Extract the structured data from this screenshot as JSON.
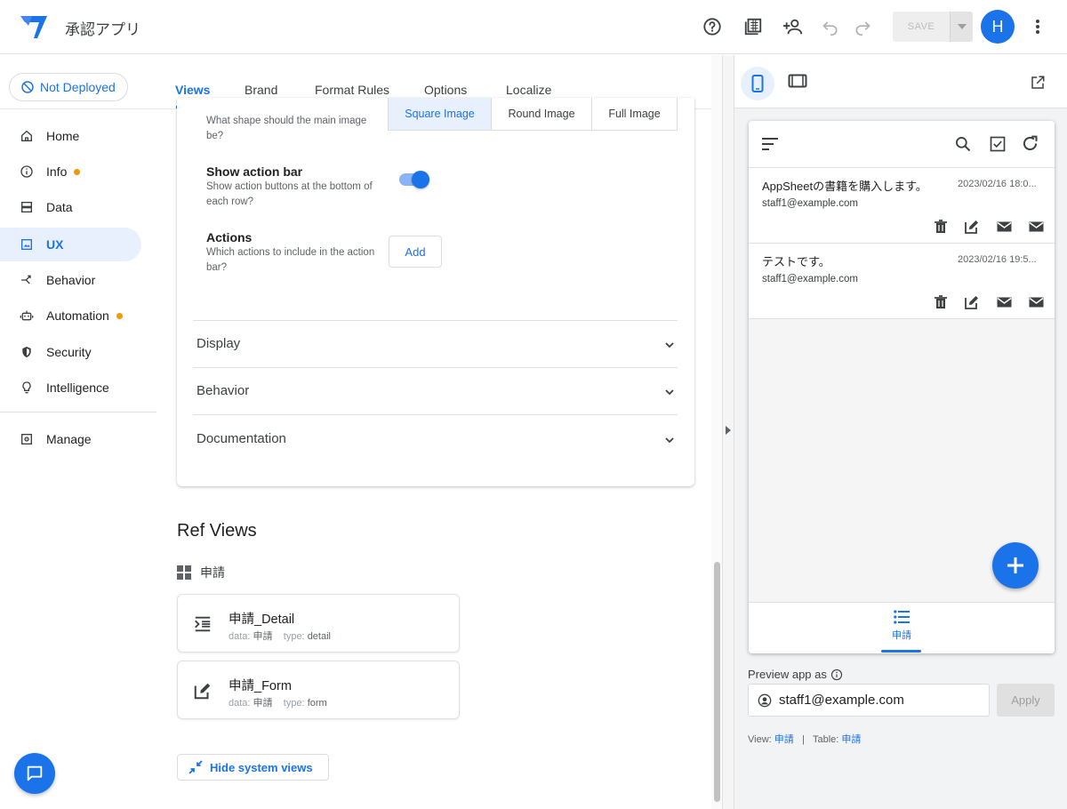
{
  "header": {
    "app_title": "承認アプリ",
    "save_label": "SAVE",
    "avatar_initial": "H",
    "icons": [
      "help-icon",
      "gallery-icon",
      "share-icon",
      "undo-icon",
      "redo-icon",
      "more-vert-icon"
    ]
  },
  "sidebar": {
    "deploy_status": "Not Deployed",
    "items": [
      {
        "label": "Home",
        "icon": "home-icon",
        "active": false,
        "dot": false
      },
      {
        "label": "Info",
        "icon": "info-icon",
        "active": false,
        "dot": true
      },
      {
        "label": "Data",
        "icon": "data-icon",
        "active": false,
        "dot": false
      },
      {
        "label": "UX",
        "icon": "ux-icon",
        "active": true,
        "dot": false
      },
      {
        "label": "Behavior",
        "icon": "behavior-icon",
        "active": false,
        "dot": false
      },
      {
        "label": "Automation",
        "icon": "automation-icon",
        "active": false,
        "dot": true
      },
      {
        "label": "Security",
        "icon": "shield-icon",
        "active": false,
        "dot": false
      },
      {
        "label": "Intelligence",
        "icon": "bulb-icon",
        "active": false,
        "dot": false
      }
    ],
    "manage_label": "Manage"
  },
  "tabs": [
    {
      "label": "Views",
      "active": true
    },
    {
      "label": "Brand",
      "active": false
    },
    {
      "label": "Format Rules",
      "active": false
    },
    {
      "label": "Options",
      "active": false
    },
    {
      "label": "Localize",
      "active": false
    }
  ],
  "settings": {
    "image_shape": {
      "desc": "What shape should the main image be?",
      "options": [
        "Square Image",
        "Round Image",
        "Full Image"
      ],
      "selected": "Square Image"
    },
    "action_bar": {
      "title": "Show action bar",
      "desc": "Show action buttons at the bottom of each row?",
      "enabled": true
    },
    "actions": {
      "title": "Actions",
      "desc": "Which actions to include in the action bar?",
      "add_label": "Add"
    },
    "sections": [
      "Display",
      "Behavior",
      "Documentation"
    ]
  },
  "ref_views": {
    "title": "Ref Views",
    "table_name": "申請",
    "items": [
      {
        "name": "申請_Detail",
        "data_label": "data:",
        "data": "申請",
        "type_label": "type:",
        "type": "detail",
        "icon": "detail-view-icon"
      },
      {
        "name": "申請_Form",
        "data_label": "data:",
        "data": "申請",
        "type_label": "type:",
        "type": "form",
        "icon": "form-view-icon"
      }
    ],
    "hide_label": "Hide system views"
  },
  "preview": {
    "rows": [
      {
        "title": "AppSheetの書籍を購入します。",
        "date": "2023/02/16 18:0...",
        "email": "staff1@example.com"
      },
      {
        "title": "テストです。",
        "date": "2023/02/16 19:5...",
        "email": "staff1@example.com"
      }
    ],
    "bottom_tab_label": "申請",
    "preview_as_label": "Preview app as",
    "preview_user": "staff1@example.com",
    "apply_label": "Apply",
    "view_label": "View:",
    "view_value": "申請",
    "separator": "|",
    "table_label": "Table:",
    "table_value": "申請"
  },
  "colors": {
    "accent": "#1a73e8",
    "active_bg": "#e8f0fe",
    "status_dot": "#f29900"
  }
}
